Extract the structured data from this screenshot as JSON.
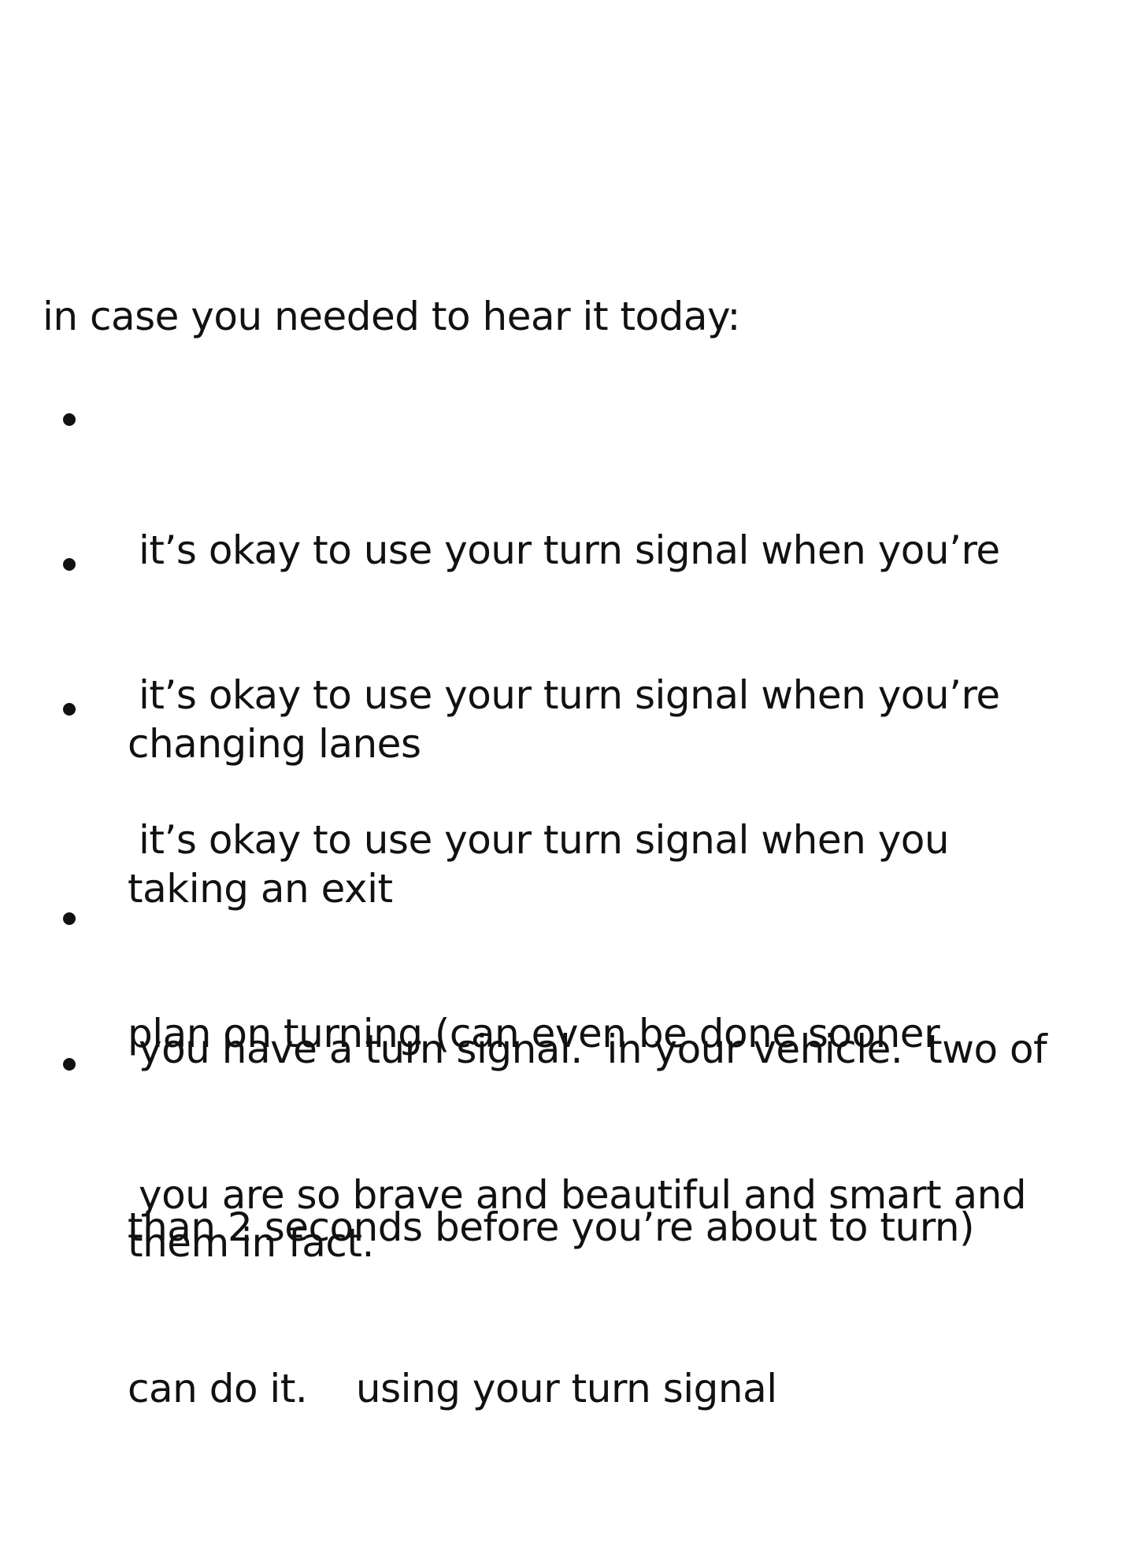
{
  "post": {
    "intro": "in case you needed to hear it today:",
    "bullets": [
      {
        "lines": [
          "it’s okay to use your turn signal when you’re",
          "changing lanes"
        ]
      },
      {
        "lines": [
          "it’s okay to use your turn signal when you’re",
          "taking an exit"
        ]
      },
      {
        "lines": [
          "it’s okay to use your turn signal when you",
          "plan on turning (can even be done sooner",
          "than 2 seconds before you’re about to turn)"
        ]
      },
      {
        "lines": [
          "you have a turn signal.  in your vehicle.  two of",
          "them in fact."
        ]
      },
      {
        "lines": [
          "you are so brave and beautiful and smart and",
          "can do it.    using your turn signal"
        ]
      }
    ]
  }
}
